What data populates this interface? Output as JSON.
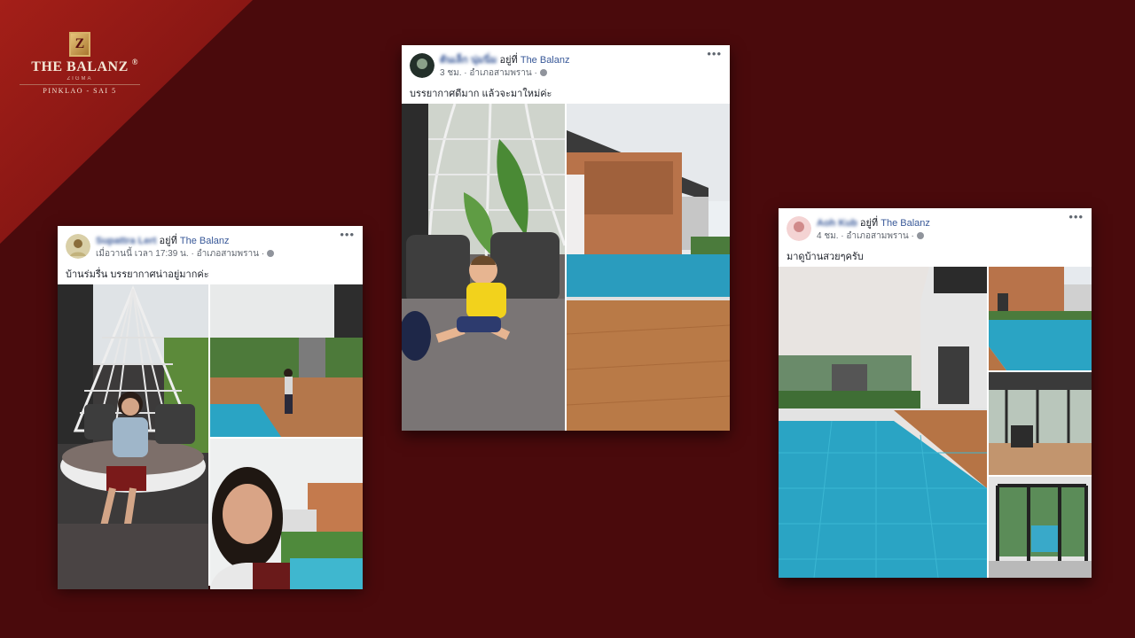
{
  "brand": {
    "logo_letter": "Z",
    "name": "THE BALANZ",
    "registered": "®",
    "subtitle": "ZIGMA",
    "location": "PINKLAO - SAI 5"
  },
  "posts": [
    {
      "author": "Supattra Lert",
      "at_text": " อยู่ที่ ",
      "page": "The Balanz",
      "time": "เมื่อวานนี้ เวลา 17:39 น.",
      "sep": " · ",
      "place": "อำเภอสามพราน",
      "privacy_glyph": "·",
      "caption": "บ้านร่มรื่น บรรยากาศน่าอยู่มากค่ะ",
      "more": "•••"
    },
    {
      "author": "ต้นเล็ก นุ่มนิ่ม",
      "at_text": " อยู่ที่ ",
      "page": "The Balanz",
      "time": "3 ชม.",
      "sep": " · ",
      "place": "อำเภอสามพราน",
      "privacy_glyph": "·",
      "caption": "บรรยากาศดีมาก แล้วจะมาใหม่ค่ะ",
      "more": "•••"
    },
    {
      "author": "Aoh Kub",
      "at_text": " อยู่ที่ ",
      "page": "The Balanz",
      "time": "4 ชม.",
      "sep": " · ",
      "place": "อำเภอสามพราน",
      "privacy_glyph": "·",
      "caption": "มาดูบ้านสวยๆครับ",
      "more": "•••"
    }
  ],
  "colors": {
    "background": "#4a0a0c",
    "corner_red": "#8e1a16",
    "link_blue": "#385898",
    "pool_blue": "#2aa4c4",
    "wood_deck": "#b26e3f"
  }
}
